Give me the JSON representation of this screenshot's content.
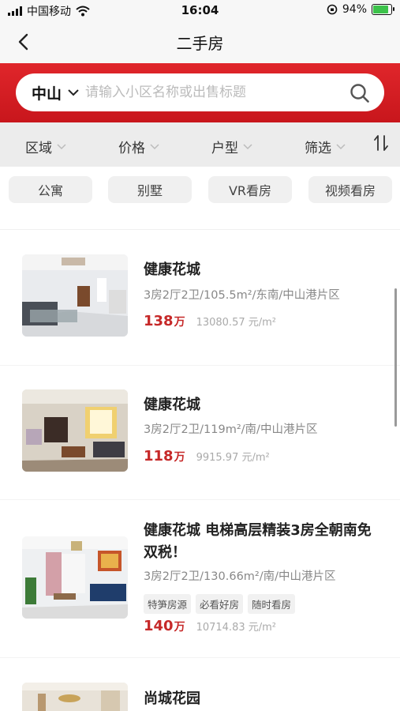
{
  "status": {
    "carrier": "中国移动",
    "time": "16:04",
    "battery": "94%",
    "battery_level": 0.94
  },
  "nav": {
    "title": "二手房"
  },
  "search": {
    "city": "中山",
    "placeholder": "请输入小区名称或出售标题"
  },
  "filters": [
    "区域",
    "价格",
    "户型",
    "筛选"
  ],
  "tags": [
    "公寓",
    "别墅",
    "VR看房",
    "视频看房"
  ],
  "listings": [
    {
      "title": "健康花城",
      "info": "3房2厅2卫/105.5m²/东南/中山港片区",
      "price": "138",
      "price_unit": "万",
      "unit_price": "13080.57 元/m²",
      "tags": []
    },
    {
      "title": "健康花城",
      "info": "3房2厅2卫/119m²/南/中山港片区",
      "price": "118",
      "price_unit": "万",
      "unit_price": "9915.97 元/m²",
      "tags": []
    },
    {
      "title": "健康花城 电梯高层精装3房全朝南免双税！",
      "info": "3房2厅2卫/130.66m²/南/中山港片区",
      "price": "140",
      "price_unit": "万",
      "unit_price": "10714.83 元/m²",
      "tags": [
        "特笋房源",
        "必看好房",
        "随时看房"
      ]
    },
    {
      "title": "尚城花园"
    }
  ],
  "colors": {
    "brand_red": "#d71f26",
    "price_red": "#c62828"
  }
}
